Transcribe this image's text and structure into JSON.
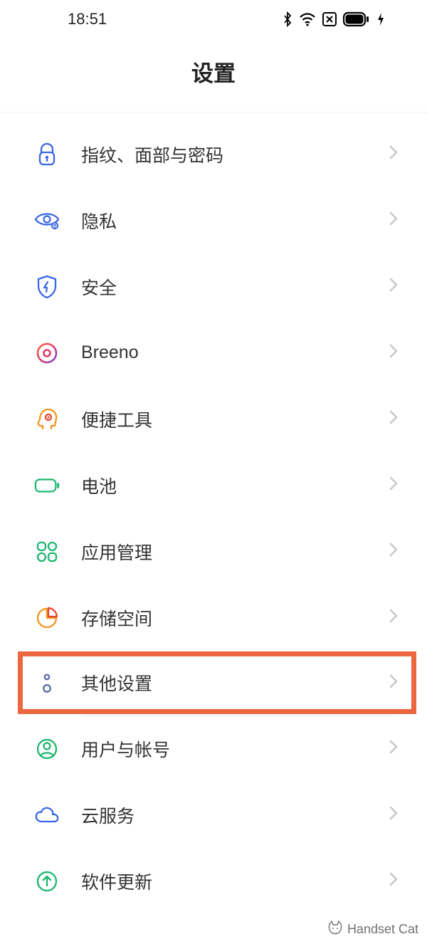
{
  "status_bar": {
    "time": "18:51"
  },
  "header": {
    "title": "设置"
  },
  "items": [
    {
      "key": "fingerprint",
      "label": "指纹、面部与密码",
      "icon": "lock-icon"
    },
    {
      "key": "privacy",
      "label": "隐私",
      "icon": "eye-icon"
    },
    {
      "key": "security",
      "label": "安全",
      "icon": "shield-icon"
    },
    {
      "key": "breeno",
      "label": "Breeno",
      "icon": "circle-dot-icon"
    },
    {
      "key": "tools",
      "label": "便捷工具",
      "icon": "head-gear-icon"
    },
    {
      "key": "battery",
      "label": "电池",
      "icon": "battery-icon"
    },
    {
      "key": "apps",
      "label": "应用管理",
      "icon": "apps-icon"
    },
    {
      "key": "storage",
      "label": "存储空间",
      "icon": "pie-icon"
    },
    {
      "key": "other",
      "label": "其他设置",
      "icon": "dots-icon",
      "highlighted": true
    },
    {
      "key": "account",
      "label": "用户与帐号",
      "icon": "user-icon"
    },
    {
      "key": "cloud",
      "label": "云服务",
      "icon": "cloud-icon"
    },
    {
      "key": "update",
      "label": "软件更新",
      "icon": "update-icon"
    }
  ],
  "watermark": {
    "text": "Handset Cat"
  },
  "icons": {
    "lock-icon": {
      "color": "#3a67e6"
    },
    "eye-icon": {
      "color": "#3a67e6"
    },
    "shield-icon": {
      "color": "#3a67e6"
    },
    "circle-dot-icon": {
      "color": "#e23a6b"
    },
    "head-gear-icon": {
      "color": "#f5941f"
    },
    "battery-icon": {
      "color": "#1bb76d"
    },
    "apps-icon": {
      "color": "#1bb76d"
    },
    "pie-icon": {
      "color": "#f5941f"
    },
    "dots-icon": {
      "color": "#5a6aa8"
    },
    "user-icon": {
      "color": "#1bb76d"
    },
    "cloud-icon": {
      "color": "#3a67e6"
    },
    "update-icon": {
      "color": "#1bb76d"
    }
  },
  "divider_after": [
    "other"
  ]
}
